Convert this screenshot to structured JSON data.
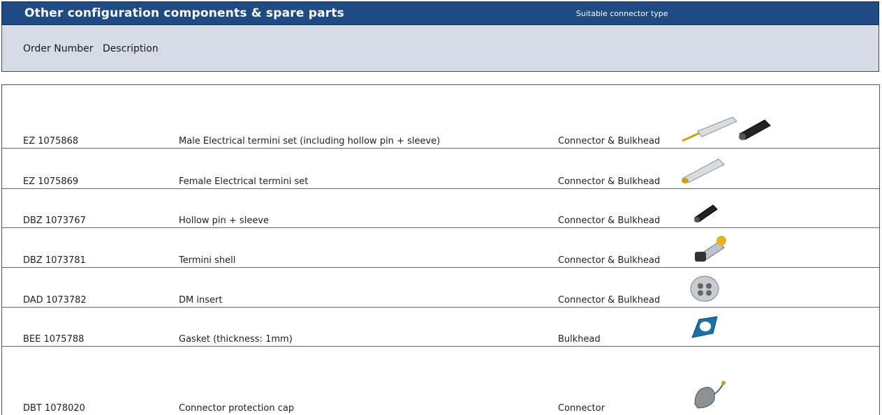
{
  "header": {
    "title": "Other configuration components & spare parts",
    "subtitle": "Suitable connector type",
    "columns": {
      "order": "Order Number",
      "description": "Description"
    }
  },
  "rows": [
    {
      "order": "EZ    1075868",
      "description": "Male Electrical termini set (including hollow pin + sleeve)",
      "connector": "Connector & Bulkhead",
      "icon": "termini-pin-and-sleeve-icon"
    },
    {
      "order": "EZ    1075869",
      "description": "Female Electrical termini set",
      "connector": "Connector & Bulkhead",
      "icon": "female-termini-icon"
    },
    {
      "order": "DBZ 1073767",
      "description": "Hollow pin + sleeve",
      "connector": "Connector & Bulkhead",
      "icon": "hollow-pin-sleeve-icon"
    },
    {
      "order": "DBZ 1073781",
      "description": "Termini shell",
      "connector": "Connector & Bulkhead",
      "icon": "termini-shell-icon"
    },
    {
      "order": "DAD 1073782",
      "description": "DM insert",
      "connector": "Connector & Bulkhead",
      "icon": "dm-insert-icon"
    },
    {
      "order": "BEE  1075788",
      "description": "Gasket (thickness: 1mm)",
      "connector": "Bulkhead",
      "icon": "gasket-icon"
    },
    {
      "order": "DBT 1078020",
      "description": "Connector protection cap",
      "connector": "Connector",
      "icon": "protection-cap-icon"
    }
  ],
  "colors": {
    "title_bar": "#1f4a82",
    "header_band": "#d6dbe6"
  }
}
